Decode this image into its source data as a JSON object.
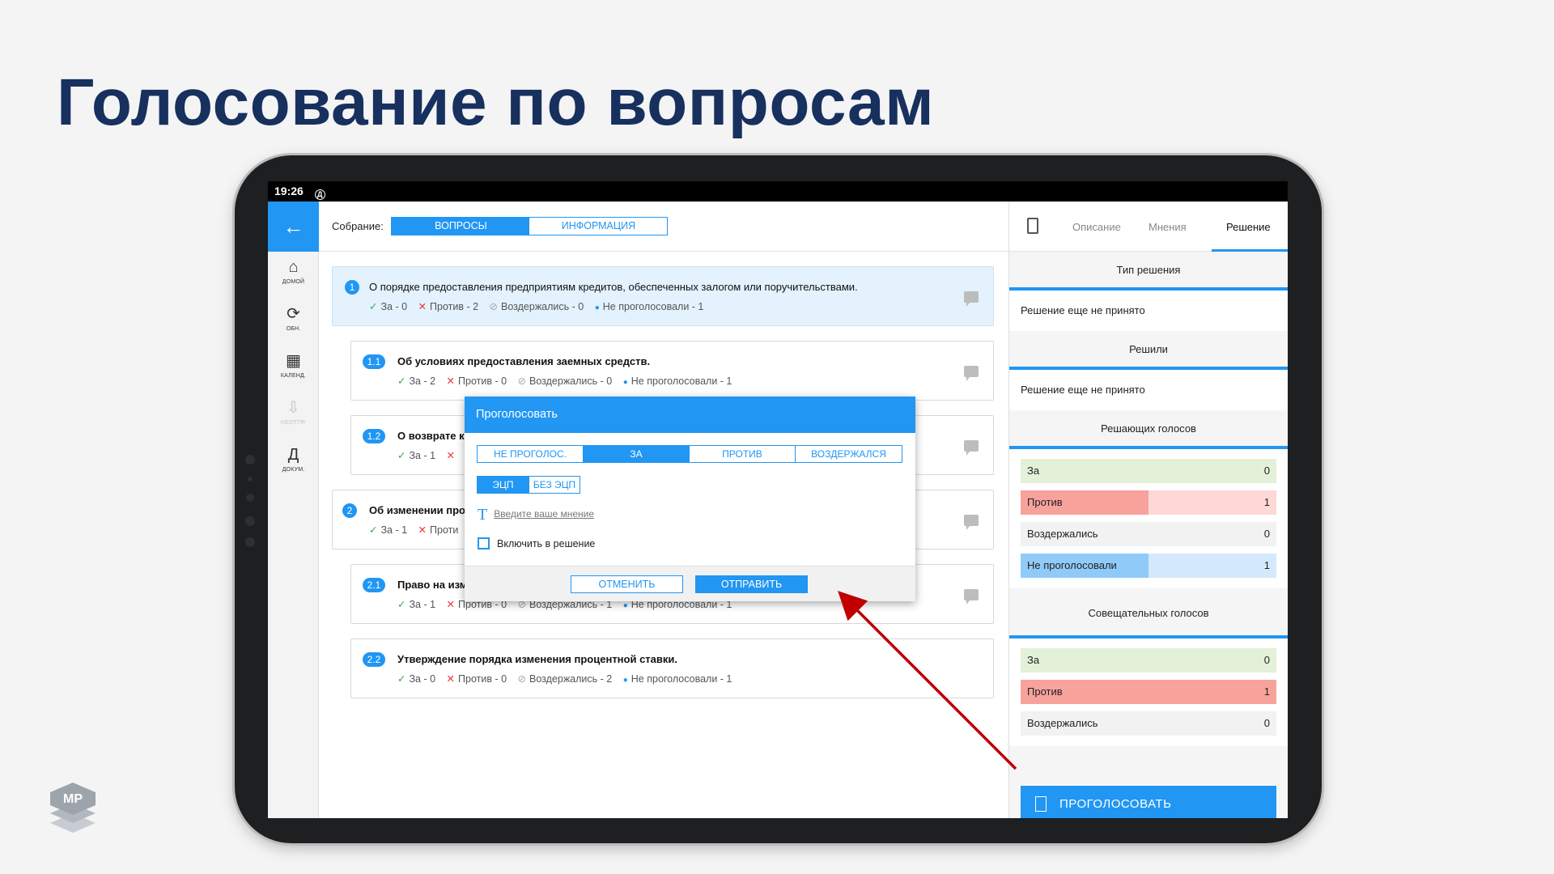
{
  "slide": {
    "title": "Голосование по вопросам"
  },
  "status": {
    "time": "19:26",
    "icon": "Д"
  },
  "sidebar": {
    "back_icon": "←",
    "items": [
      {
        "icon": "⌂",
        "label": "ДОМОЙ"
      },
      {
        "icon": "⟳",
        "label": "ОБН."
      },
      {
        "icon": "▦",
        "label": "КАЛЕНД."
      },
      {
        "icon": "⇩",
        "label": "НЕОТПР."
      },
      {
        "icon": "Д",
        "label": "ДОКУМ."
      }
    ]
  },
  "topbar": {
    "label": "Собрание:",
    "tab_questions": "ВОПРОСЫ",
    "tab_info": "ИНФОРМАЦИЯ"
  },
  "questions": [
    {
      "num": "1",
      "title": "О порядке предоставления предприятиям кредитов, обеспеченных залогом или поручительствами.",
      "for": "За - 0",
      "against": "Против - 2",
      "abstain": "Воздержались - 0",
      "not_voted": "Не проголосовали - 1"
    },
    {
      "num": "1.1",
      "title": "Об условиях предоставления заемных средств.",
      "for": "За - 2",
      "against": "Против - 0",
      "abstain": "Воздержались - 0",
      "not_voted": "Не проголосовали - 1"
    },
    {
      "num": "1.2",
      "title": "О возврате к",
      "for": "За - 1",
      "against": "",
      "abstain": "",
      "not_voted": ""
    },
    {
      "num": "2",
      "title": "Об изменении про",
      "for": "За - 1",
      "against": "Проти",
      "abstain": "",
      "not_voted": ""
    },
    {
      "num": "2.1",
      "title": "Право на изм",
      "for": "За - 1",
      "against": "Против - 0",
      "abstain": "Воздержались - 1",
      "not_voted": "Не проголосовали - 1"
    },
    {
      "num": "2.2",
      "title": "Утверждение порядка изменения процентной ставки.",
      "for": "За - 0",
      "against": "Против - 0",
      "abstain": "Воздержались - 2",
      "not_voted": "Не проголосовали - 1"
    }
  ],
  "right_tabs": {
    "description": "Описание",
    "opinions": "Мнения",
    "decision": "Решение"
  },
  "right_panel": {
    "decision_type_header": "Тип решения",
    "decision_type_value": "Решение еще не принято",
    "decided_header": "Решили",
    "decided_value": "Решение еще не принято",
    "deciding_header": "Решающих голосов",
    "deciding": [
      {
        "label": "За",
        "count": "0",
        "fraction": 1.0
      },
      {
        "label": "Против",
        "count": "1",
        "fraction": 0.5
      },
      {
        "label": "Воздержались",
        "count": "0",
        "fraction": 0
      },
      {
        "label": "Не проголосовали",
        "count": "1",
        "fraction": 0.5
      }
    ],
    "advisory_header": "Совещательных голосов",
    "advisory": [
      {
        "label": "За",
        "count": "0",
        "fraction": 1.0
      },
      {
        "label": "Против",
        "count": "1",
        "fraction": 1.0
      },
      {
        "label": "Воздержались",
        "count": "0",
        "fraction": 0
      }
    ],
    "vote_button": "ПРОГОЛОСОВАТЬ"
  },
  "dialog": {
    "title": "Проголосовать",
    "options": [
      "НЕ ПРОГОЛОС.",
      "ЗА",
      "ПРОТИВ",
      "ВОЗДЕРЖАЛСЯ"
    ],
    "signature_options": [
      "ЭЦП",
      "БЕЗ ЭЦП"
    ],
    "opinion_placeholder": "Введите ваше мнение",
    "include_label": "Включить в решение",
    "cancel": "ОТМЕНИТЬ",
    "send": "ОТПРАВИТЬ"
  },
  "colors": {
    "accent": "#2196f3",
    "title": "#17305e",
    "for_bg": "#e3f1d9",
    "against_bg": "#f8a29c",
    "against_track": "#fdd8d5",
    "notvoted_bg": "#90caf9",
    "notvoted_track": "#d4e9fb",
    "arrow": "#c00000"
  }
}
